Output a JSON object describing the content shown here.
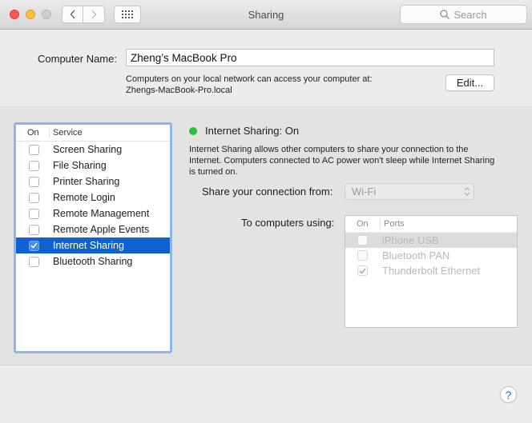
{
  "window": {
    "title": "Sharing",
    "search_placeholder": "Search",
    "icons": {
      "back": "chevron-left-icon",
      "forward": "chevron-right-icon",
      "show_all": "grid-icon",
      "search": "magnifier-icon"
    }
  },
  "computer_name": {
    "label": "Computer Name:",
    "value": "Zheng’s MacBook Pro",
    "note_line1": "Computers on your local network can access your computer at:",
    "note_line2": "Zhengs-MacBook-Pro.local",
    "edit_label": "Edit..."
  },
  "services": {
    "header_on": "On",
    "header_service": "Service",
    "items": [
      {
        "label": "Screen Sharing",
        "checked": false,
        "selected": false
      },
      {
        "label": "File Sharing",
        "checked": false,
        "selected": false
      },
      {
        "label": "Printer Sharing",
        "checked": false,
        "selected": false
      },
      {
        "label": "Remote Login",
        "checked": false,
        "selected": false
      },
      {
        "label": "Remote Management",
        "checked": false,
        "selected": false
      },
      {
        "label": "Remote Apple Events",
        "checked": false,
        "selected": false
      },
      {
        "label": "Internet Sharing",
        "checked": true,
        "selected": true
      },
      {
        "label": "Bluetooth Sharing",
        "checked": false,
        "selected": false
      }
    ]
  },
  "detail": {
    "status_text": "Internet Sharing: On",
    "status_color": "#27c33a",
    "description": "Internet Sharing allows other computers to share your connection to the Internet. Computers connected to AC power won't sleep while Internet Sharing is turned on.",
    "share_from_label": "Share your connection from:",
    "share_from_value": "Wi-Fi",
    "to_computers_label": "To computers using:",
    "ports_header_on": "On",
    "ports_header_ports": "Ports",
    "ports": [
      {
        "label": "iPhone USB",
        "checked": false,
        "highlighted": true
      },
      {
        "label": "Bluetooth PAN",
        "checked": false,
        "highlighted": false
      },
      {
        "label": "Thunderbolt Ethernet",
        "checked": true,
        "highlighted": false
      }
    ]
  },
  "help": {
    "label": "?"
  }
}
